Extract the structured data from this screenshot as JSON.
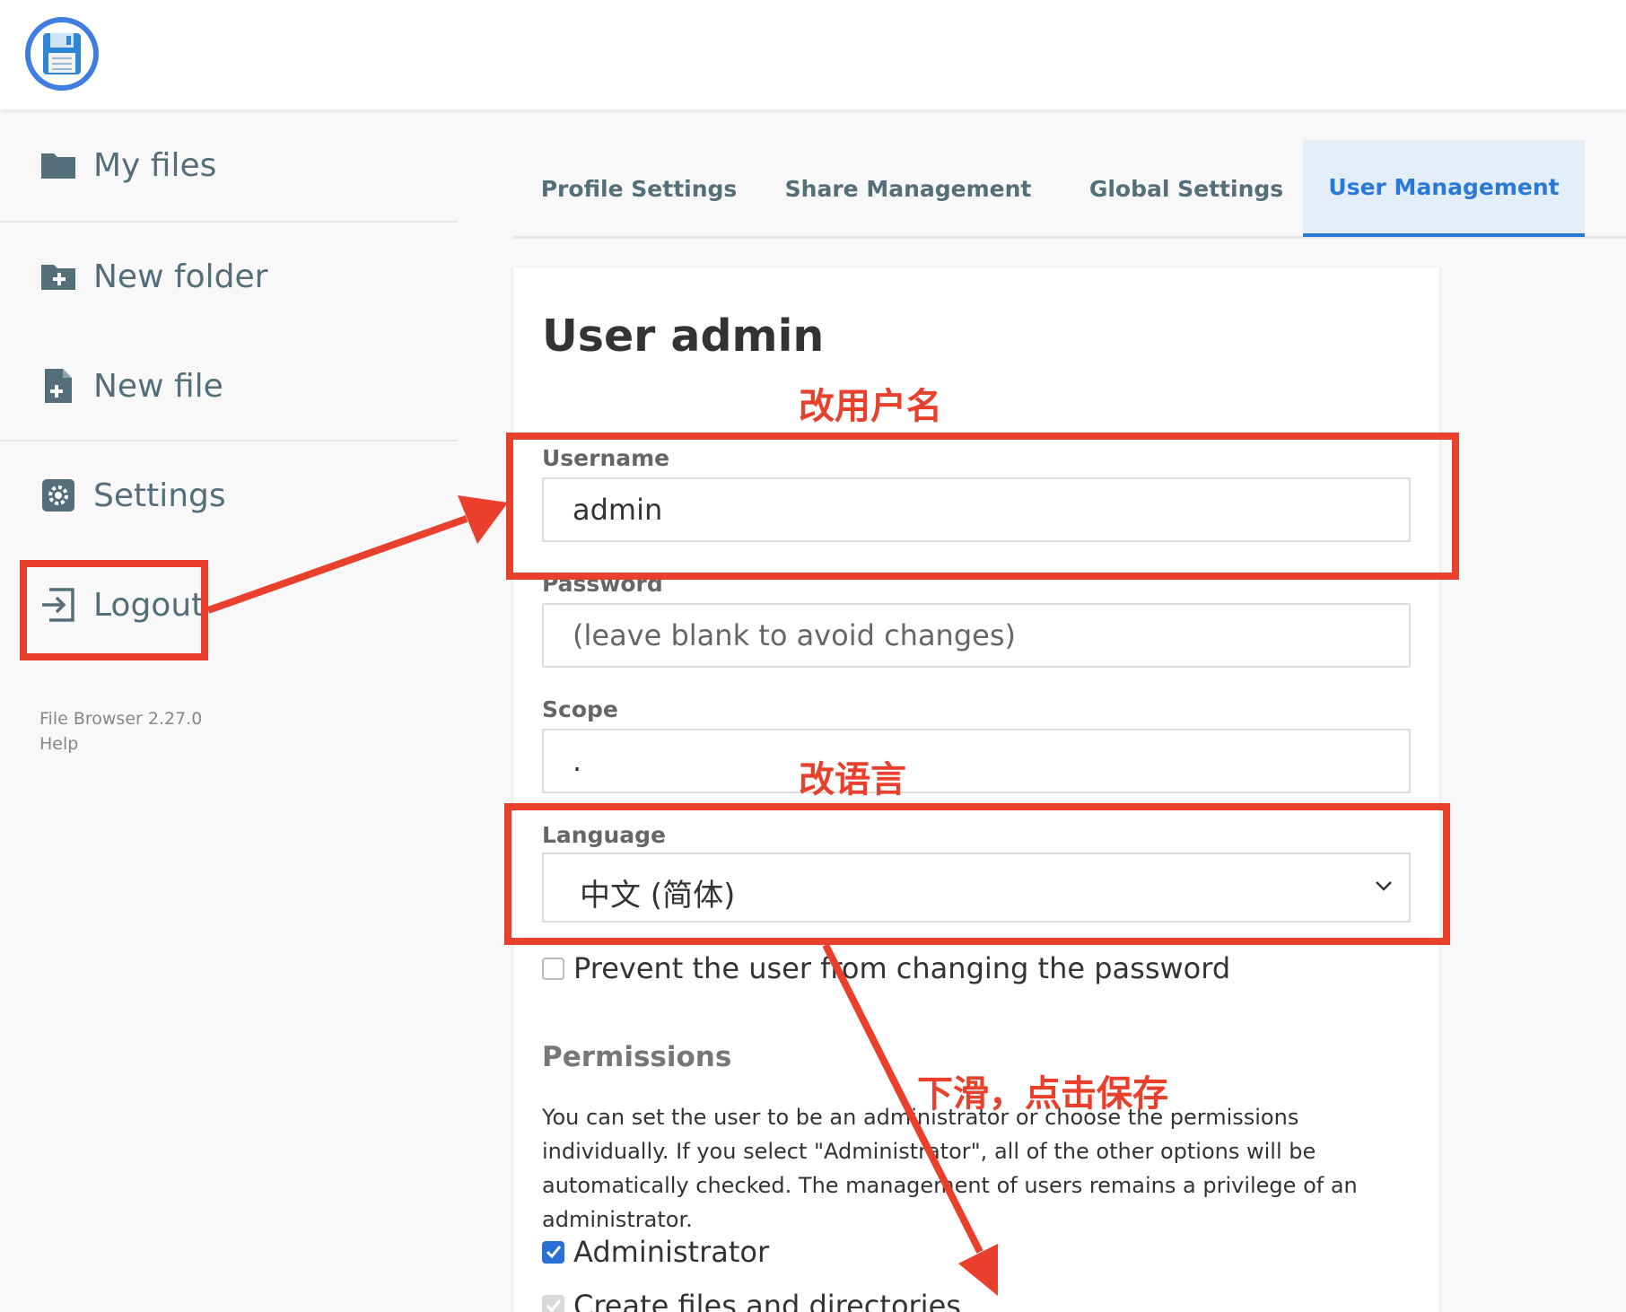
{
  "sidebar": {
    "items": [
      {
        "label": "My files",
        "icon": "folder-icon"
      },
      {
        "label": "New folder",
        "icon": "folder-plus-icon"
      },
      {
        "label": "New file",
        "icon": "file-plus-icon"
      },
      {
        "label": "Settings",
        "icon": "gear-icon"
      },
      {
        "label": "Logout",
        "icon": "logout-icon"
      }
    ],
    "version": "File Browser 2.27.0",
    "help": "Help"
  },
  "tabs": [
    {
      "label": "Profile Settings",
      "active": false
    },
    {
      "label": "Share Management",
      "active": false
    },
    {
      "label": "Global Settings",
      "active": false
    },
    {
      "label": "User Management",
      "active": true
    }
  ],
  "form": {
    "title": "User admin",
    "username_label": "Username",
    "username_value": "admin",
    "password_label": "Password",
    "password_placeholder": "(leave blank to avoid changes)",
    "scope_label": "Scope",
    "scope_value": ".",
    "language_label": "Language",
    "language_value": "中文 (简体)",
    "prevent_password_change": "Prevent the user from changing the password",
    "permissions_title": "Permissions",
    "permissions_desc": "You can set the user to be an administrator or choose the permissions individually. If you select \"Administrator\", all of the other options will be automatically checked. The management of users remains a privilege of an administrator.",
    "administrator_label": "Administrator",
    "administrator_checked": true,
    "create_files_label": "Create files and directories"
  },
  "annotations": {
    "rename_user": "改用户名",
    "change_language": "改语言",
    "scroll_save": "下滑，点击保存"
  },
  "colors": {
    "accent": "#2979d8",
    "annotation": "#e8402c",
    "sidebar_text": "#546e7a"
  }
}
